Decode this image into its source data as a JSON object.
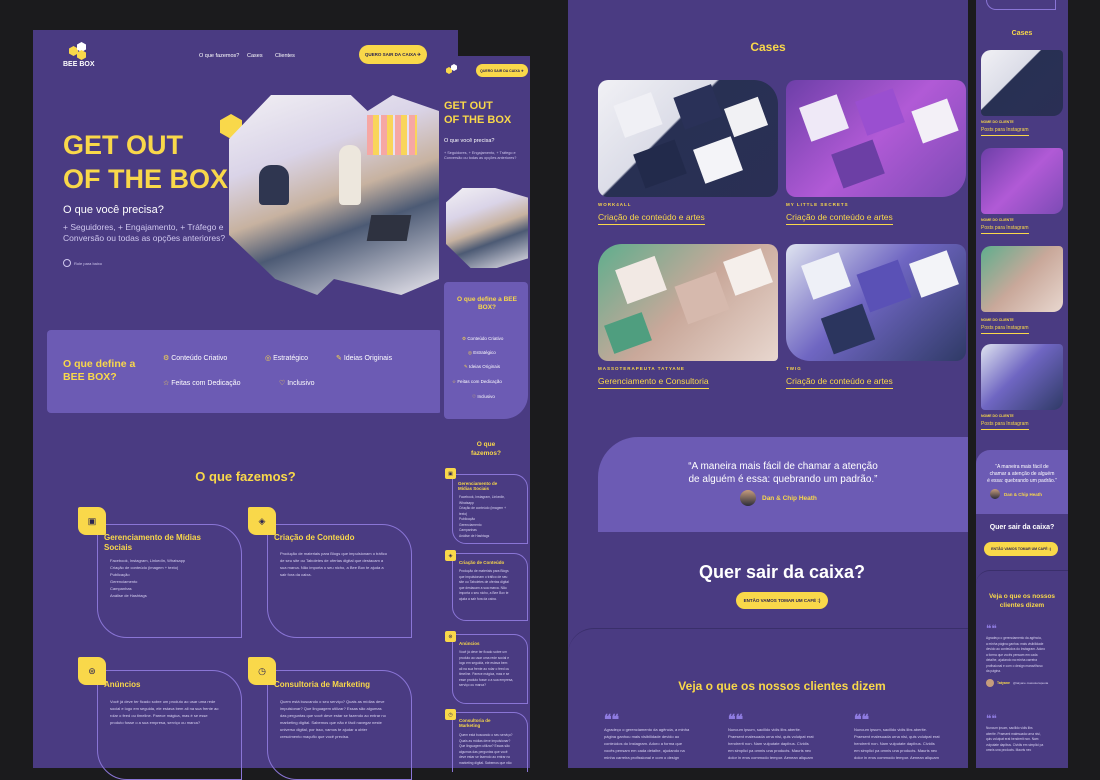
{
  "brand": {
    "logo": "BEE BOX",
    "tagline": "marketing"
  },
  "nav": {
    "items": [
      "O que fazemos?",
      "Cases",
      "Clientes"
    ],
    "cta": "QUERO SAIR DA CAIXA ✈"
  },
  "hero": {
    "title_line1": "GET OUT",
    "title_line2": "OF THE BOX",
    "subtitle": "O que você precisa?",
    "desc": "+ Seguidores, + Engajamento, + Tráfego e Conversão ou todas as opções anteriores?",
    "scroll": "Role para baixo"
  },
  "define": {
    "title": "O que define a BEE BOX?",
    "items": [
      "Conteúdo Criativo",
      "Estratégico",
      "Ideias Originais",
      "Feitas com Dedicação",
      "Inclusivo"
    ]
  },
  "services": {
    "title": "O que fazemos?",
    "items": [
      {
        "title": "Gerenciamento de Mídias Sociais",
        "lines": [
          "Facebook, Instagram, LinkedIn, Whatsapp",
          "Criação de conteúdo (imagem + texto)",
          "Publicação",
          "Gerenciamento",
          "Campanhas",
          "Análise de Hashtags"
        ]
      },
      {
        "title": "Criação de Conteúdo",
        "lines": [
          "Produção de materiais para Blogs que impulsionam o tráfico",
          "de seu site ou Taboletes de ofertas digital que destacam a",
          "sua marca. Não importa o seu nicho, a Bee Box te ajuda a",
          "sair fora da caixa."
        ]
      },
      {
        "title": "Anúncios",
        "lines": [
          "Você já deve ter ficado sobre um produto ao usar uma rede",
          "social e logo em seguida, ele estava bem ali na sua frente ao",
          "rolar o feed ou timeline. Parece mágica, mas é se esse",
          "produto fosse o a sua empresa, serviço ou marca?"
        ]
      },
      {
        "title": "Consultoria de Marketing",
        "lines": [
          "Quem está buscando o seu serviço? Quais as mídias deve",
          "impulsionar? Que linguagem utilizar? Essas são algumas",
          "das perguntas que você deve estar se fazendo ao entrar no",
          "marketing digital. Sabemos que não é fácil navegar neste",
          "universo digital, por isso, vamos te ajudar a obter",
          "crescimento maçuflo que você precisa."
        ]
      }
    ]
  },
  "mobile": {
    "cta": "QUERO SAIR DA CAIXA ✈",
    "title_line1": "GET OUT",
    "title_line2": "OF THE BOX",
    "subtitle": "O que você precisa?",
    "desc": "+ Seguidores, + Engajamento, + Tráfego e Conversão ou todas as opções anteriores?",
    "define_title": "O que define a BEE BOX?",
    "services_title": "O que fazemos?",
    "services": [
      {
        "title": "Gerenciamento de Mídias Sociais",
        "lines": [
          "Facebook, Instagram, LinkedIn,",
          "Whatsapp",
          "Criação de conteúdo (imagem +",
          "texto)",
          "Publicação",
          "Gerenciamento",
          "Campanhas",
          "Análise de Hashtags"
        ]
      },
      {
        "title": "Criação de Conteúdo",
        "lines": [
          "Produção de materiais para Blogs",
          "que impulsionam o tráfico de seu",
          "site ou Taboletes de ofertas digital",
          "que destacam a sua marca. Não",
          "importa o seu nicho, a Bee Box te",
          "ajuda a sair fora da caixa."
        ]
      },
      {
        "title": "Anúncios",
        "lines": [
          "Você já deve ter ficado sobre um",
          "produto ao usar uma rede social e",
          "logo em seguida, ele estava bem",
          "ali na sua frente ao rolar o feed ou",
          "timeline. Parece mágica, mas e se",
          "esse produto fosse o a sua empresa,",
          "serviço ou marca?"
        ]
      },
      {
        "title": "Consultoria de Marketing",
        "lines": [
          "Quem está buscando o seu serviço?",
          "Quais as mídias deve impulsionar?",
          "Que linguagem utilizar? Essas são",
          "algumas das perguntas que você",
          "deve estar se fazendo ao entrar no",
          "marketing digital. Sabemos que não"
        ]
      }
    ]
  },
  "cases": {
    "title": "Cases",
    "items": [
      {
        "client": "WORK4ALL",
        "service": "Criação de conteúdo e artes"
      },
      {
        "client": "MY LITTLE SECRETS",
        "service": "Criação de conteúdo e artes"
      },
      {
        "client": "MASSOTERAPEUTA TATYANE",
        "service": "Gerenciamento e Consultoria"
      },
      {
        "client": "TWIG",
        "service": "Criação de conteúdo e artes"
      }
    ]
  },
  "quote": {
    "text_line1": "“A maneira mais fácil de chamar a atenção",
    "text_line2": "de alguém é essa: quebrando um padrão.”",
    "author": "Dan & Chip Heath"
  },
  "cta_section": {
    "title": "Quer sair da caixa?",
    "button": "ENTÃO VAMOS TOMAR UM CAFÉ :)"
  },
  "testimonials": {
    "title": "Veja o que os nossos clientes dizem",
    "items": [
      {
        "lines": [
          "Agradeço o gerenciamento da agência, a minha",
          "página ganhou mais visibilidade devido ao",
          "conteúdos do Instagram. Adoro a forma que",
          "vocês pensam em cada detalhe, ajudando na",
          "minha carreira profissional e com o design"
        ]
      },
      {
        "lines": [
          "Nuncum ipsum, sacilldo vidis libs aberite.",
          "Praesent malesuada urna nisi, quis volutpat erat",
          "hendrerit non. Nam vulputate dapibus. Cividis",
          "em simplici pa omnis una products. Mauris nec",
          "dolor in eros commodo tempor. Aenean aliquam"
        ]
      },
      {
        "lines": [
          "Nuncum ipsum, sacilldo vidis libs aberite.",
          "Praesent malesuada urna nisi, quis volutpat erat",
          "hendrerit non. Nam vulputate dapibus. Cividis",
          "em simplici pa omnis una products. Mauris nec",
          "dolor in eros commodo tempor. Aenean aliquam"
        ]
      }
    ]
  },
  "right_mobile": {
    "cases_title": "Cases",
    "label": "NOME DO CLIENTE",
    "service": "Posts para Instagram",
    "quote_line1": "“A maneira mais fácil de",
    "quote_line2": "chamar a atenção de alguém",
    "quote_line3": "é essa: quebrando um padrão.”",
    "author": "Dan & Chip Heath",
    "cta_title": "Quer sair da caixa?",
    "cta_button": "ENTÃO VAMOS TOMAR UM CAFÉ :)",
    "testimonials_title_line1": "Veja o que os nossos",
    "testimonials_title_line2": "clientes dizem",
    "testimonial_lines": [
      "Agradeço o gerenciamento da agência,",
      "a minha página ganhou mais visibilidade",
      "devido ao conteúdos do Instagram. Adoro",
      "a forma que vocês pensam em cada",
      "detalhe, ajudando na minha carreira",
      "profissional e com o design maravilhoso",
      "da página."
    ],
    "testimonial_author": "Tatyane",
    "testimonial_handle": "@tatyane.massoterapeuta",
    "testimonial2_lines": [
      "Nuncum ipsum, sacilldo vidis libs",
      "aberite. Praesent malesuada urna nisi,",
      "quis volutpat erat hendrerit non. Nam",
      "vulputate dapibus. Cividis em simplici pa",
      "omnis una products. Mauris nec"
    ]
  }
}
